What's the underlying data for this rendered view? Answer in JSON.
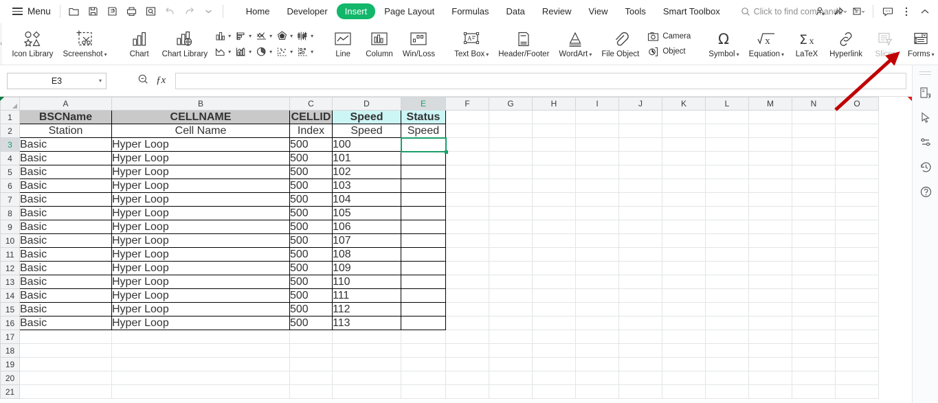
{
  "app": {
    "menu_label": "Menu",
    "accent_color": "#12b76a",
    "annotation_color": "#c00000",
    "selection_color": "#1a9e6a"
  },
  "quick_access": [
    {
      "name": "open-icon",
      "title": "Open"
    },
    {
      "name": "save-icon",
      "title": "Save"
    },
    {
      "name": "save-as-icon",
      "title": "Save As"
    },
    {
      "name": "print-icon",
      "title": "Print"
    },
    {
      "name": "print-preview-icon",
      "title": "Print Preview"
    },
    {
      "name": "undo-icon",
      "title": "Undo"
    },
    {
      "name": "redo-icon",
      "title": "Redo"
    },
    {
      "name": "customize-quick-access-icon",
      "title": "Customize"
    }
  ],
  "tabs": [
    {
      "label": "Home",
      "active": false
    },
    {
      "label": "Developer",
      "active": false
    },
    {
      "label": "Insert",
      "active": true
    },
    {
      "label": "Page Layout",
      "active": false
    },
    {
      "label": "Formulas",
      "active": false
    },
    {
      "label": "Data",
      "active": false
    },
    {
      "label": "Review",
      "active": false
    },
    {
      "label": "View",
      "active": false
    },
    {
      "label": "Tools",
      "active": false
    },
    {
      "label": "Smart Toolbox",
      "active": false
    }
  ],
  "search": {
    "placeholder": "Click to find commands",
    "label": "Click to find commands"
  },
  "top_right_icons": [
    {
      "name": "share-user-icon"
    },
    {
      "name": "share-icon"
    },
    {
      "name": "collaborate-icon"
    },
    {
      "name": "comment-icon"
    },
    {
      "name": "more-options-icon"
    },
    {
      "name": "collapse-ribbon-icon"
    }
  ],
  "ribbon": {
    "collapse_label": "‹",
    "groups": [
      {
        "name": "illustrations",
        "buttons": [
          {
            "label": "Icon Library",
            "icon": "icon-library-icon",
            "dropdown": false,
            "disabled": false
          },
          {
            "label": "Screenshot",
            "icon": "screenshot-icon",
            "dropdown": true,
            "disabled": false
          }
        ]
      },
      {
        "name": "charts",
        "buttons": [
          {
            "label": "Chart",
            "icon": "chart-icon",
            "dropdown": false,
            "disabled": false
          },
          {
            "label": "Chart Library",
            "icon": "chart-library-icon",
            "dropdown": false,
            "disabled": false
          }
        ],
        "mini_buttons": [
          {
            "name": "column-chart-icon",
            "dropdown": true
          },
          {
            "name": "bar-chart-icon",
            "dropdown": true
          },
          {
            "name": "line-chart-icon",
            "dropdown": true
          },
          {
            "name": "radar-chart-icon",
            "dropdown": true
          },
          {
            "name": "stock-chart-icon",
            "dropdown": true
          },
          {
            "name": "area-chart-icon",
            "dropdown": true
          },
          {
            "name": "combo-chart-icon",
            "dropdown": true
          },
          {
            "name": "pie-chart-icon",
            "dropdown": true
          },
          {
            "name": "scatter-chart-icon",
            "dropdown": true
          },
          {
            "name": "bubble-chart-icon",
            "dropdown": true
          }
        ]
      },
      {
        "name": "sparklines",
        "buttons": [
          {
            "label": "Line",
            "icon": "sparkline-line-icon",
            "dropdown": false,
            "disabled": false
          },
          {
            "label": "Column",
            "icon": "sparkline-column-icon",
            "dropdown": false,
            "disabled": false
          },
          {
            "label": "Win/Loss",
            "icon": "sparkline-winloss-icon",
            "dropdown": false,
            "disabled": false
          }
        ]
      },
      {
        "name": "text-objects",
        "buttons": [
          {
            "label": "Text Box",
            "icon": "text-box-icon",
            "dropdown": true,
            "disabled": false
          },
          {
            "label": "Header/Footer",
            "icon": "header-footer-icon",
            "dropdown": false,
            "disabled": false
          },
          {
            "label": "WordArt",
            "icon": "wordart-icon",
            "dropdown": true,
            "disabled": false
          },
          {
            "label": "File Object",
            "icon": "file-object-icon",
            "dropdown": false,
            "disabled": false
          }
        ],
        "stacked": [
          {
            "label": "Camera",
            "icon": "camera-icon"
          },
          {
            "label": "Object",
            "icon": "object-icon"
          }
        ]
      },
      {
        "name": "symbols",
        "buttons": [
          {
            "label": "Symbol",
            "icon": "symbol-omega-icon",
            "dropdown": true,
            "disabled": false
          },
          {
            "label": "Equation",
            "icon": "equation-icon",
            "dropdown": true,
            "disabled": false
          },
          {
            "label": "LaTeX",
            "icon": "latex-icon",
            "dropdown": false,
            "disabled": false
          },
          {
            "label": "Hyperlink",
            "icon": "hyperlink-icon",
            "dropdown": false,
            "disabled": false
          },
          {
            "label": "Slicer",
            "icon": "slicer-icon",
            "dropdown": false,
            "disabled": true
          },
          {
            "label": "Forms",
            "icon": "forms-icon",
            "dropdown": true,
            "disabled": false
          }
        ]
      }
    ]
  },
  "formula_bar": {
    "name_box_value": "E3",
    "formula_value": "",
    "zoom_icon": "zoom-find-icon",
    "fx_label": "ƒx"
  },
  "sheet": {
    "columns": [
      "A",
      "B",
      "C",
      "D",
      "E",
      "F",
      "G",
      "H",
      "I",
      "J",
      "K",
      "L",
      "M",
      "N",
      "O"
    ],
    "selected_column": "E",
    "selected_row": 3,
    "selected_cell": "E3",
    "rows": [
      1,
      2,
      3,
      4,
      5,
      6,
      7,
      8,
      9,
      10,
      11,
      12,
      13,
      14,
      15,
      16,
      17,
      18,
      19,
      20,
      21
    ],
    "header_row_1": [
      {
        "text": "BSCName",
        "fill": "grey"
      },
      {
        "text": "CELLNAME",
        "fill": "grey"
      },
      {
        "text": "CELLID",
        "fill": "grey"
      },
      {
        "text": "Speed",
        "fill": "cyan"
      },
      {
        "text": "Status",
        "fill": "cyan"
      }
    ],
    "header_row_2": [
      {
        "text": "Station",
        "comment": true
      },
      {
        "text": "Cell Name",
        "comment": true
      },
      {
        "text": "Index",
        "comment": true
      },
      {
        "text": "Speed",
        "comment": true
      },
      {
        "text": "Speed",
        "comment": true
      }
    ],
    "data_rows": [
      {
        "row": 3,
        "BSCName": "Basic",
        "CELLNAME": "Hyper Loop",
        "CELLID": "500",
        "Speed": "100",
        "Status": ""
      },
      {
        "row": 4,
        "BSCName": "Basic",
        "CELLNAME": "Hyper Loop",
        "CELLID": "500",
        "Speed": "101",
        "Status": ""
      },
      {
        "row": 5,
        "BSCName": "Basic",
        "CELLNAME": "Hyper Loop",
        "CELLID": "500",
        "Speed": "102",
        "Status": ""
      },
      {
        "row": 6,
        "BSCName": "Basic",
        "CELLNAME": "Hyper Loop",
        "CELLID": "500",
        "Speed": "103",
        "Status": ""
      },
      {
        "row": 7,
        "BSCName": "Basic",
        "CELLNAME": "Hyper Loop",
        "CELLID": "500",
        "Speed": "104",
        "Status": ""
      },
      {
        "row": 8,
        "BSCName": "Basic",
        "CELLNAME": "Hyper Loop",
        "CELLID": "500",
        "Speed": "105",
        "Status": ""
      },
      {
        "row": 9,
        "BSCName": "Basic",
        "CELLNAME": "Hyper Loop",
        "CELLID": "500",
        "Speed": "106",
        "Status": ""
      },
      {
        "row": 10,
        "BSCName": "Basic",
        "CELLNAME": "Hyper Loop",
        "CELLID": "500",
        "Speed": "107",
        "Status": ""
      },
      {
        "row": 11,
        "BSCName": "Basic",
        "CELLNAME": "Hyper Loop",
        "CELLID": "500",
        "Speed": "108",
        "Status": ""
      },
      {
        "row": 12,
        "BSCName": "Basic",
        "CELLNAME": "Hyper Loop",
        "CELLID": "500",
        "Speed": "109",
        "Status": ""
      },
      {
        "row": 13,
        "BSCName": "Basic",
        "CELLNAME": "Hyper Loop",
        "CELLID": "500",
        "Speed": "110",
        "Status": ""
      },
      {
        "row": 14,
        "BSCName": "Basic",
        "CELLNAME": "Hyper Loop",
        "CELLID": "500",
        "Speed": "111",
        "Status": ""
      },
      {
        "row": 15,
        "BSCName": "Basic",
        "CELLNAME": "Hyper Loop",
        "CELLID": "500",
        "Speed": "112",
        "Status": ""
      },
      {
        "row": 16,
        "BSCName": "Basic",
        "CELLNAME": "Hyper Loop",
        "CELLID": "500",
        "Speed": "113",
        "Status": ""
      }
    ]
  },
  "right_sidebar": [
    {
      "name": "sidebar-layout-icon"
    },
    {
      "name": "sidebar-cursor-icon"
    },
    {
      "name": "sidebar-settings-icon"
    },
    {
      "name": "sidebar-history-icon"
    },
    {
      "name": "sidebar-help-icon"
    }
  ]
}
